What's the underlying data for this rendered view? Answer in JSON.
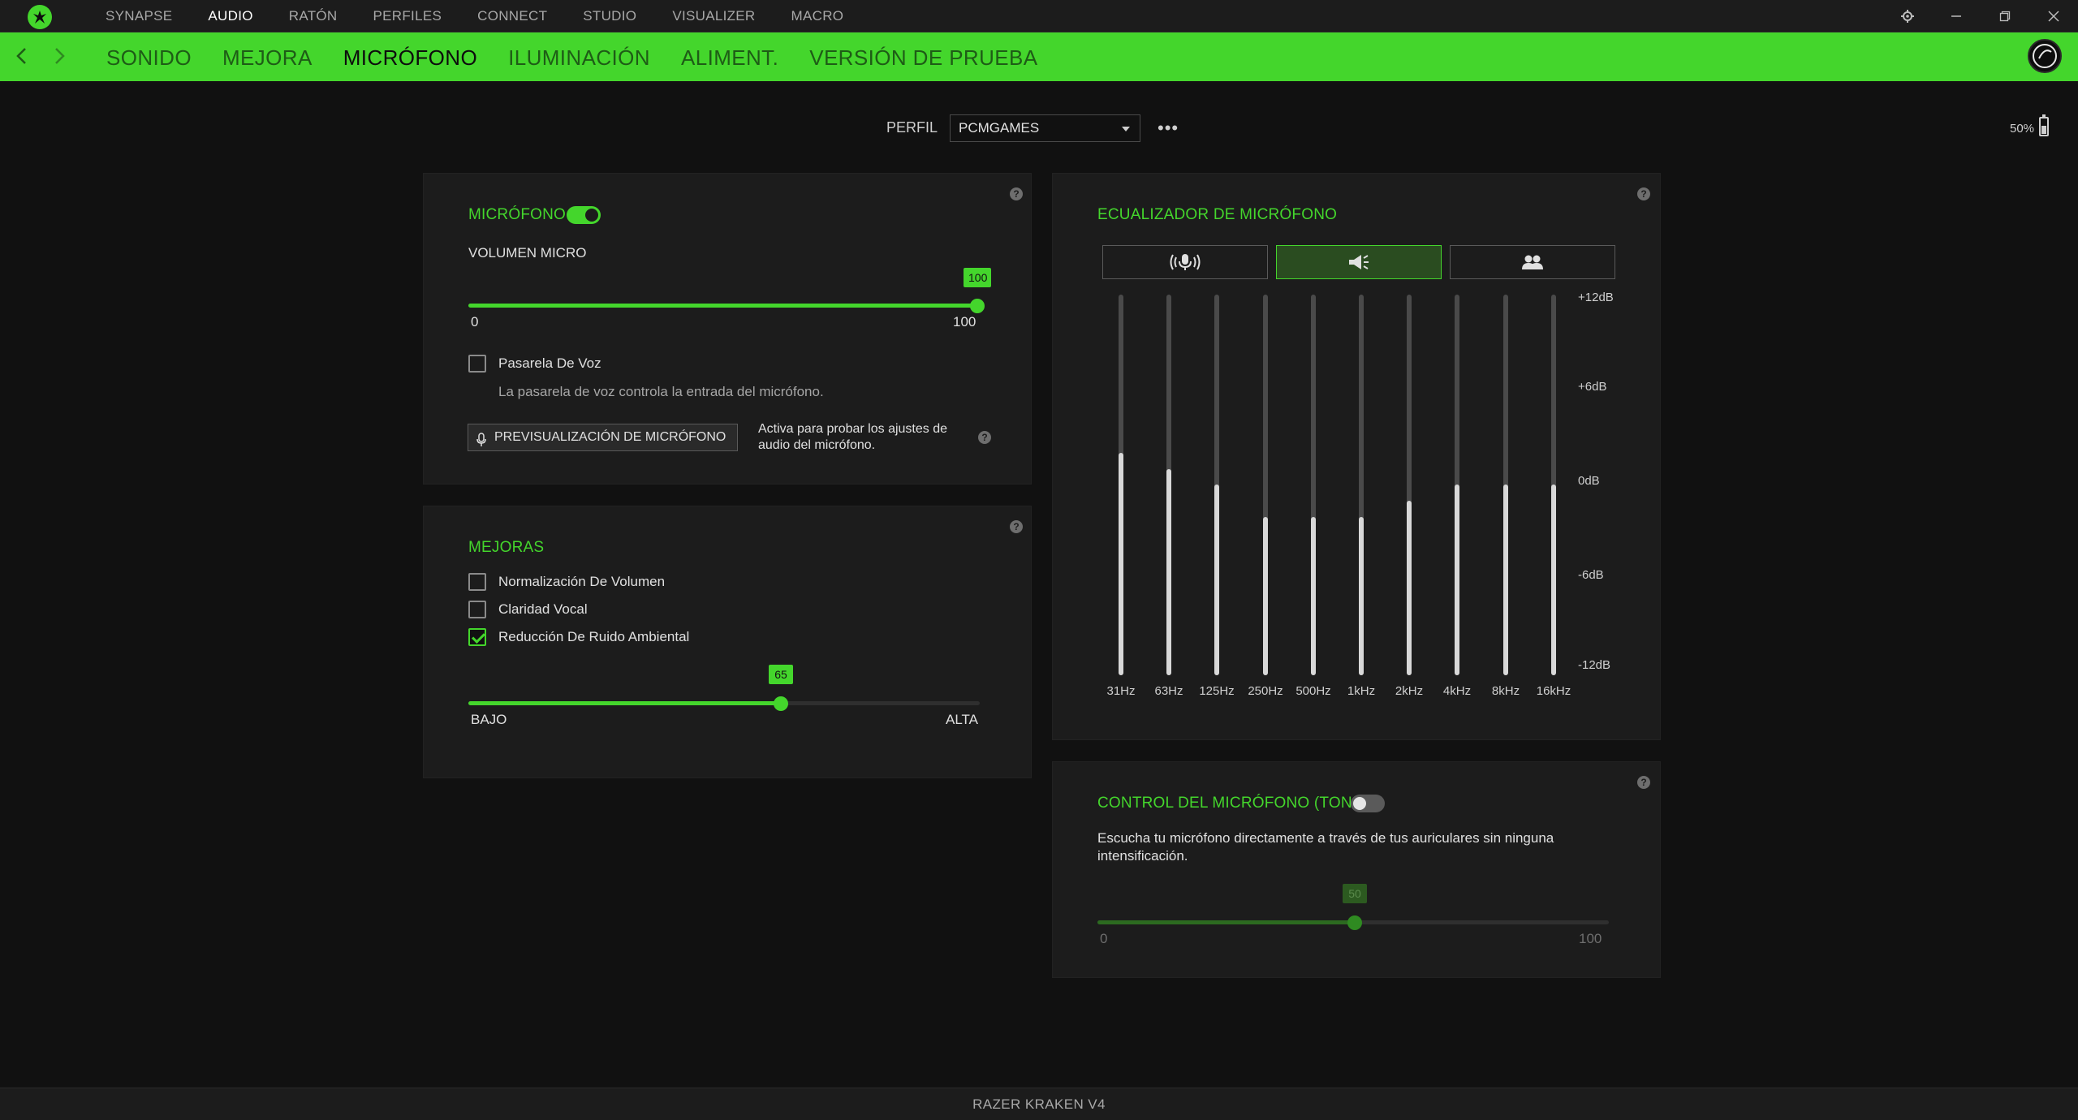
{
  "topnav": {
    "items": [
      "SYNAPSE",
      "AUDIO",
      "RATÓN",
      "PERFILES",
      "CONNECT",
      "STUDIO",
      "VISUALIZER",
      "MACRO"
    ],
    "active": "AUDIO"
  },
  "subnav": {
    "tabs": [
      "SONIDO",
      "MEJORA",
      "MICRÓFONO",
      "ILUMINACIÓN",
      "ALIMENT.",
      "VERSIÓN DE PRUEBA"
    ],
    "active": "MICRÓFONO"
  },
  "profile": {
    "label": "PERFIL",
    "value": "PCMGAMES",
    "more": "•••"
  },
  "battery": {
    "text": "50%",
    "level": 0.5
  },
  "mic_panel": {
    "title": "MICRÓFONO",
    "enabled": true,
    "volume_label": "VOLUMEN MICRO",
    "volume_value": "100",
    "volume_min": "0",
    "volume_max": "100",
    "voice_gate_label": "Pasarela De Voz",
    "voice_gate_checked": false,
    "voice_gate_desc": "La pasarela de voz controla la entrada del micrófono.",
    "preview_button": "PREVISUALIZACIÓN DE MICRÓFONO",
    "preview_desc_line1": "Activa para probar los ajustes de",
    "preview_desc_line2": "audio del micrófono."
  },
  "enhancements": {
    "title": "MEJORAS",
    "options": [
      {
        "label": "Normalización De Volumen",
        "checked": false
      },
      {
        "label": "Claridad Vocal",
        "checked": false
      },
      {
        "label": "Reducción De Ruido Ambiental",
        "checked": true
      }
    ],
    "noise_value": "65",
    "noise_min": "BAJO",
    "noise_max": "ALTA"
  },
  "equalizer": {
    "title": "ECUALIZADOR DE MICRÓFONO",
    "presets": [
      "broadcast-mic-icon",
      "megaphone-icon",
      "group-icon"
    ],
    "active_preset": 1,
    "db_labels": [
      "+12dB",
      "+6dB",
      "0dB",
      "-6dB",
      "-12dB"
    ],
    "bands": [
      "31Hz",
      "63Hz",
      "125Hz",
      "250Hz",
      "500Hz",
      "1kHz",
      "2kHz",
      "4kHz",
      "8kHz",
      "16kHz"
    ],
    "gains_db": [
      2,
      1,
      0,
      -2,
      -2,
      -2,
      -1,
      0,
      0,
      0
    ]
  },
  "sidetone": {
    "title": "CONTROL DEL MICRÓFONO (TONO)",
    "enabled": false,
    "desc_line1": "Escucha tu micrófono directamente a través de tus auriculares sin ninguna",
    "desc_line2": "intensificación.",
    "value": "50",
    "min": "0",
    "max": "100"
  },
  "footer": {
    "device": "RAZER KRAKEN V4"
  },
  "colors": {
    "accent": "#44d62c",
    "background": "#111111",
    "panel": "#1c1c1c"
  }
}
